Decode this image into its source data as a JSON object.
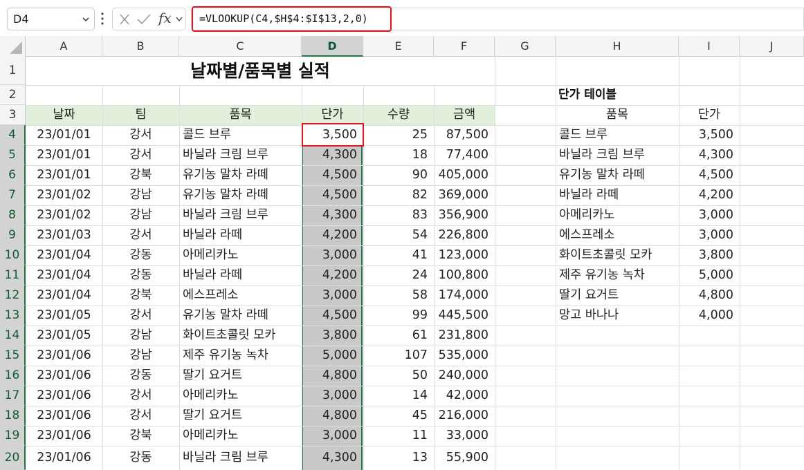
{
  "name_box": {
    "value": "D4"
  },
  "formula_bar": {
    "fx_label": "fx",
    "formula": "=VLOOKUP(C4,$H$4:$I$13,2,0)"
  },
  "columns": [
    "A",
    "B",
    "C",
    "D",
    "E",
    "F",
    "G",
    "H",
    "I",
    "J"
  ],
  "selected_column": "D",
  "rows": [
    "1",
    "2",
    "3",
    "4",
    "5",
    "6",
    "7",
    "8",
    "9",
    "10",
    "11",
    "12",
    "13",
    "14",
    "15",
    "16",
    "17",
    "18",
    "19",
    "20"
  ],
  "selected_rows": [
    "4",
    "5",
    "6",
    "7",
    "8",
    "9",
    "10",
    "11",
    "12",
    "13",
    "14",
    "15",
    "16",
    "17",
    "18",
    "19",
    "20"
  ],
  "main_table": {
    "title": "날짜별/품목별 실적",
    "headers": [
      "날짜",
      "팀",
      "품목",
      "단가",
      "수량",
      "금액"
    ],
    "rows": [
      [
        "23/01/01",
        "강서",
        "콜드 브루",
        "3,500",
        "25",
        "87,500"
      ],
      [
        "23/01/01",
        "강서",
        "바닐라 크림 브루",
        "4,300",
        "18",
        "77,400"
      ],
      [
        "23/01/01",
        "강북",
        "유기농 말차 라떼",
        "4,500",
        "90",
        "405,000"
      ],
      [
        "23/01/02",
        "강남",
        "유기농 말차 라떼",
        "4,500",
        "82",
        "369,000"
      ],
      [
        "23/01/02",
        "강남",
        "바닐라 크림 브루",
        "4,300",
        "83",
        "356,900"
      ],
      [
        "23/01/03",
        "강서",
        "바닐라 라떼",
        "4,200",
        "54",
        "226,800"
      ],
      [
        "23/01/04",
        "강동",
        "아메리카노",
        "3,000",
        "41",
        "123,000"
      ],
      [
        "23/01/04",
        "강동",
        "바닐라 라떼",
        "4,200",
        "24",
        "100,800"
      ],
      [
        "23/01/04",
        "강북",
        "에스프레소",
        "3,000",
        "58",
        "174,000"
      ],
      [
        "23/01/05",
        "강서",
        "유기농 말차 라떼",
        "4,500",
        "99",
        "445,500"
      ],
      [
        "23/01/05",
        "강남",
        "화이트초콜릿 모카",
        "3,800",
        "61",
        "231,800"
      ],
      [
        "23/01/06",
        "강남",
        "제주 유기농 녹차",
        "5,000",
        "107",
        "535,000"
      ],
      [
        "23/01/06",
        "강동",
        "딸기 요거트",
        "4,800",
        "50",
        "240,000"
      ],
      [
        "23/01/06",
        "강서",
        "아메리카노",
        "3,000",
        "14",
        "42,000"
      ],
      [
        "23/01/06",
        "강서",
        "딸기 요거트",
        "4,800",
        "45",
        "216,000"
      ],
      [
        "23/01/06",
        "강북",
        "아메리카노",
        "3,000",
        "11",
        "33,000"
      ],
      [
        "23/01/06",
        "강동",
        "바닐라 크림 브루",
        "4,300",
        "13",
        "55,900"
      ]
    ]
  },
  "price_table": {
    "title": "단가 테이블",
    "headers": [
      "품목",
      "단가"
    ],
    "rows": [
      [
        "콜드 브루",
        "3,500"
      ],
      [
        "바닐라 크림 브루",
        "4,300"
      ],
      [
        "유기농 말차 라떼",
        "4,500"
      ],
      [
        "바닐라 라떼",
        "4,200"
      ],
      [
        "아메리카노",
        "3,000"
      ],
      [
        "에스프레소",
        "3,000"
      ],
      [
        "화이트초콜릿 모카",
        "3,800"
      ],
      [
        "제주 유기농 녹차",
        "5,000"
      ],
      [
        "딸기 요거트",
        "4,800"
      ],
      [
        "망고 바나나",
        "4,000"
      ]
    ]
  },
  "colors": {
    "accent_green": "#217346",
    "highlight_red": "#e0141e",
    "header_band": "#e2efda"
  }
}
